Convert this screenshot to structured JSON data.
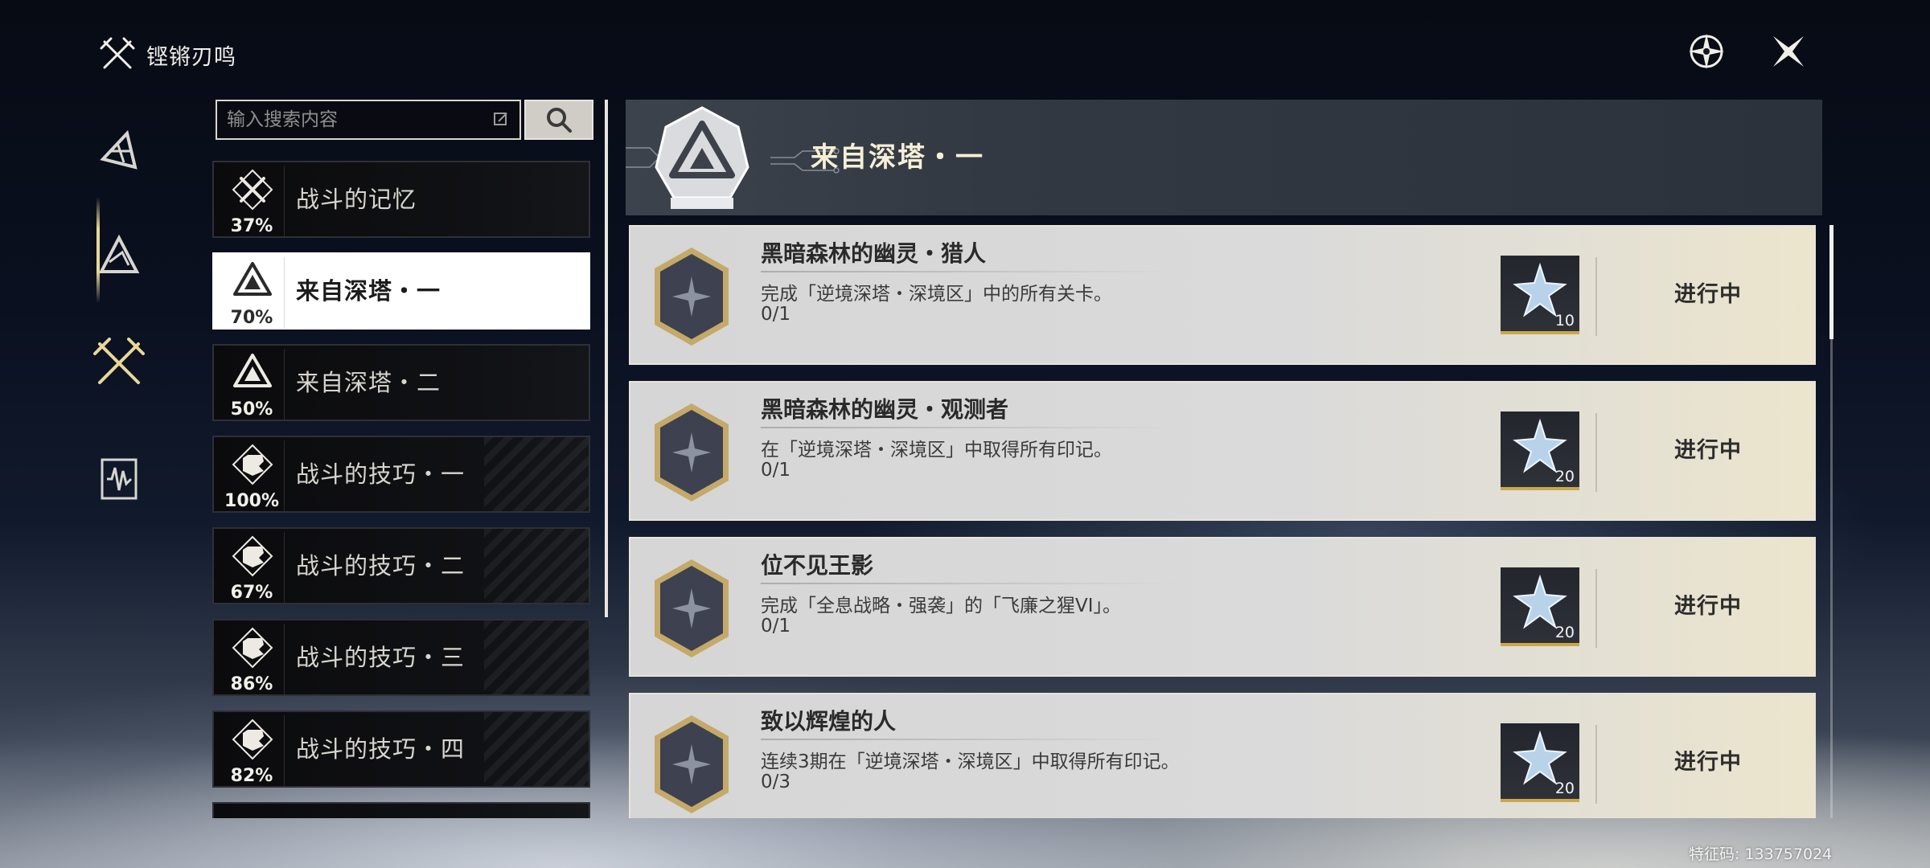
{
  "header": {
    "title": "铿锵刃鸣",
    "logo_icon": "crossed-swords-icon",
    "compass_icon": "compass-icon",
    "close_icon": "close-icon"
  },
  "nav": {
    "items": [
      {
        "icon": "triangle-glyph-icon"
      },
      {
        "icon": "mountain-glyph-icon"
      },
      {
        "icon": "crossed-swords-icon",
        "active": true
      },
      {
        "icon": "waveform-card-icon"
      }
    ]
  },
  "search": {
    "placeholder": "输入搜索内容",
    "edit_icon": "edit-icon",
    "button_icon": "search-icon"
  },
  "categories": [
    {
      "name": "战斗的记忆",
      "percent": "37%",
      "icon": "swords-badge-icon",
      "textured": false
    },
    {
      "name": "来自深塔・一",
      "percent": "70%",
      "icon": "tower-badge-icon",
      "active": true
    },
    {
      "name": "来自深塔・二",
      "percent": "50%",
      "icon": "tower-badge-icon"
    },
    {
      "name": "战斗的技巧・一",
      "percent": "100%",
      "icon": "fist-badge-icon",
      "textured": true
    },
    {
      "name": "战斗的技巧・二",
      "percent": "67%",
      "icon": "fist-badge-icon",
      "textured": true
    },
    {
      "name": "战斗的技巧・三",
      "percent": "86%",
      "icon": "fist-badge-icon",
      "textured": true
    },
    {
      "name": "战斗的技巧・四",
      "percent": "82%",
      "icon": "fist-badge-icon",
      "textured": true
    }
  ],
  "detail": {
    "title": "来自深塔・一",
    "emblem_icon": "tower-emblem-icon"
  },
  "achievements": [
    {
      "title": "黑暗森林的幽灵・猎人",
      "description": "完成「逆境深塔・深境区」中的所有关卡。",
      "progress": "0/1",
      "reward_qty": "10",
      "status": "进行中"
    },
    {
      "title": "黑暗森林的幽灵・观测者",
      "description": "在「逆境深塔・深境区」中取得所有印记。",
      "progress": "0/1",
      "reward_qty": "20",
      "status": "进行中"
    },
    {
      "title": "位不见王影",
      "description": "完成「全息战略・强袭」的「飞廉之猩VI」。",
      "progress": "0/1",
      "reward_qty": "20",
      "status": "进行中"
    },
    {
      "title": "致以辉煌的人",
      "description": "连续3期在「逆境深塔・深境区」中取得所有印记。",
      "progress": "0/3",
      "reward_qty": "20",
      "status": "进行中"
    }
  ],
  "footer": {
    "code": "特征码: 133757024"
  },
  "colors": {
    "accent_gold": "#e9d896",
    "active_bg": "#ffffff",
    "card_bg": "#d8d8d8"
  }
}
